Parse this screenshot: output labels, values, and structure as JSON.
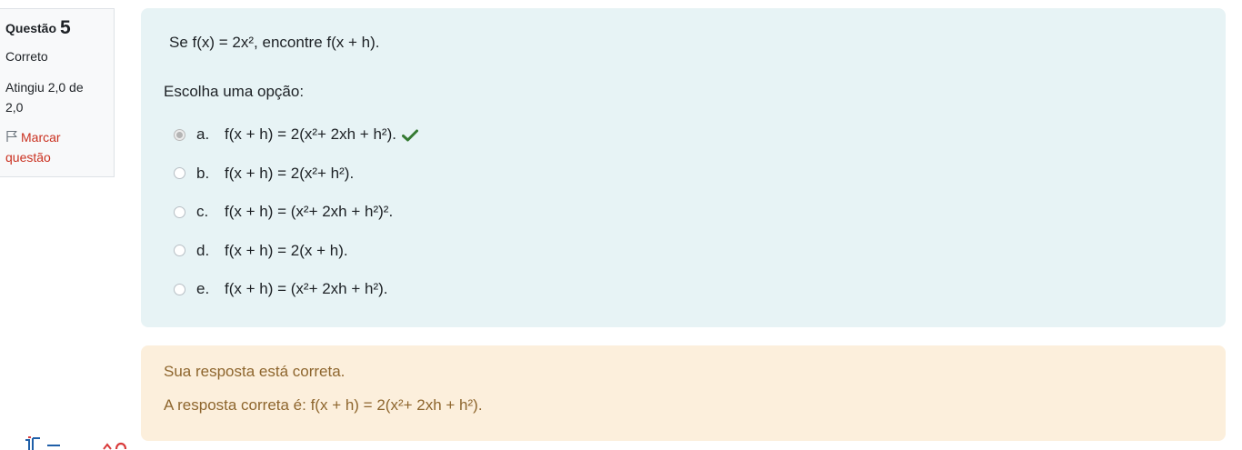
{
  "question_info": {
    "label": "Questão",
    "number": "5",
    "state": "Correto",
    "grade": "Atingiu 2,0 de 2,0",
    "flag_label": "Marcar questão"
  },
  "question": {
    "text": "Se f(x) = 2x², encontre f(x + h).",
    "prompt": "Escolha uma opção:",
    "options": [
      {
        "letter": "a.",
        "text": "f(x + h) = 2(x²+ 2xh + h²).",
        "selected": true,
        "correct": true
      },
      {
        "letter": "b.",
        "text": "f(x + h) = 2(x²+ h²).",
        "selected": false
      },
      {
        "letter": "c.",
        "text": "f(x + h) = (x²+ 2xh + h²)².",
        "selected": false
      },
      {
        "letter": "d.",
        "text": "f(x + h) = 2(x + h).",
        "selected": false
      },
      {
        "letter": "e.",
        "text": "f(x + h) = (x²+ 2xh + h²).",
        "selected": false
      }
    ]
  },
  "outcome": {
    "feedback": "Sua resposta está correta.",
    "right_answer": "A resposta correta é: f(x + h) = 2(x²+ 2xh + h²)."
  },
  "colors": {
    "formulation_bg": "#e7f3f5",
    "outcome_bg": "#fcefdc",
    "outcome_text": "#8e662e",
    "flag_red": "#ca3120",
    "check_green": "#357a32"
  },
  "icons": {
    "flag": "flag-outline-icon",
    "correct": "checkmark-icon"
  }
}
